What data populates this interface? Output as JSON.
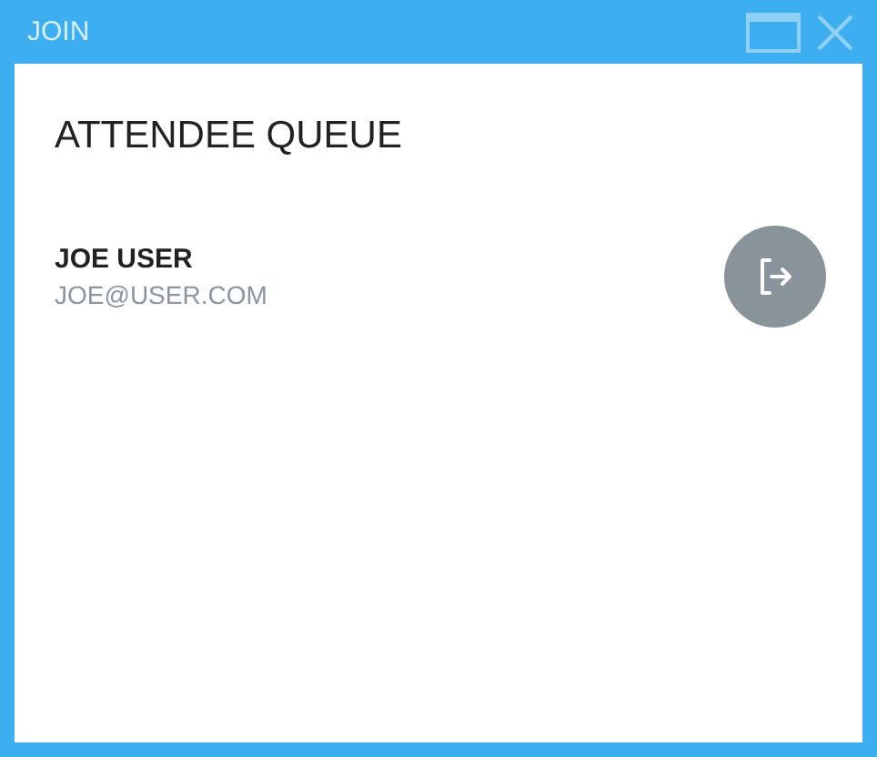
{
  "window": {
    "title": "JOIN"
  },
  "heading": "ATTENDEE QUEUE",
  "attendees": [
    {
      "name": "JOE USER",
      "email": "JOE@USER.COM"
    }
  ]
}
